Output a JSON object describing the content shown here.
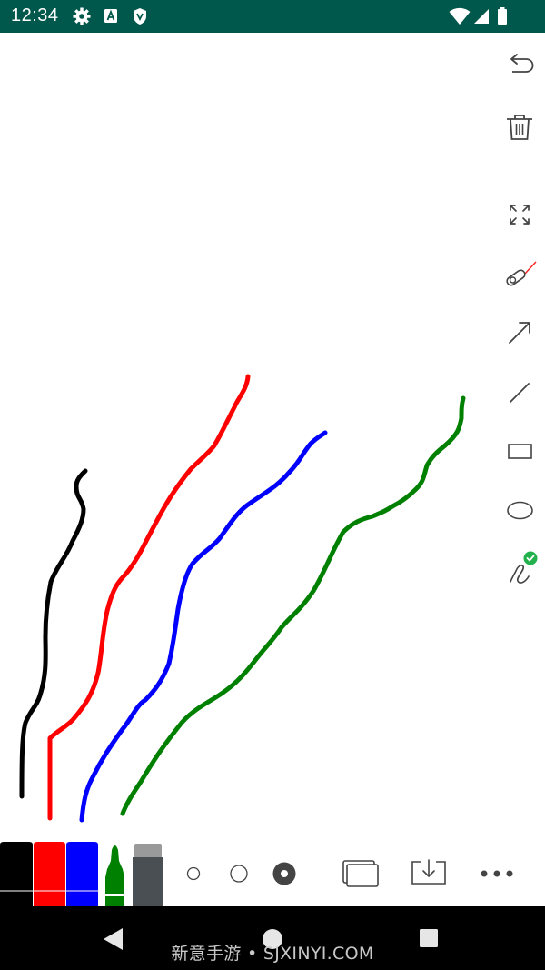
{
  "status_bar": {
    "time": "12:34",
    "background": "#00574b",
    "left_icons": [
      "gear-icon",
      "font-a-icon",
      "shield-icon"
    ],
    "right_icons": [
      "wifi-icon",
      "signal-icon",
      "battery-icon"
    ]
  },
  "toolbar_right": {
    "tools": [
      {
        "name": "undo-icon"
      },
      {
        "name": "trash-icon"
      },
      {
        "name": "fullscreen-icon"
      },
      {
        "name": "laser-pointer-icon"
      },
      {
        "name": "arrow-tool-icon"
      },
      {
        "name": "line-tool-icon"
      },
      {
        "name": "rectangle-tool-icon"
      },
      {
        "name": "ellipse-tool-icon"
      },
      {
        "name": "freehand-tool-icon",
        "selected": true
      }
    ],
    "selected_badge_color": "#22b14c"
  },
  "strokes": [
    {
      "color": "#000000"
    },
    {
      "color": "#ff0000"
    },
    {
      "color": "#0000ff"
    },
    {
      "color": "#008000"
    }
  ],
  "bottom_bar": {
    "pens": [
      {
        "name": "black-pen",
        "color": "#000000"
      },
      {
        "name": "red-pen",
        "color": "#ff0000"
      },
      {
        "name": "blue-pen",
        "color": "#0000ff"
      },
      {
        "name": "green-highlighter",
        "color": "#008000"
      },
      {
        "name": "eraser",
        "color": "#4a4f54"
      }
    ],
    "sizes": [
      "small",
      "medium",
      "large"
    ],
    "selected_size": "large",
    "actions": [
      "pages-icon",
      "save-icon",
      "more-icon"
    ]
  },
  "nav_bar": {
    "watermark": "新意手游 • SJXINYI.COM"
  }
}
